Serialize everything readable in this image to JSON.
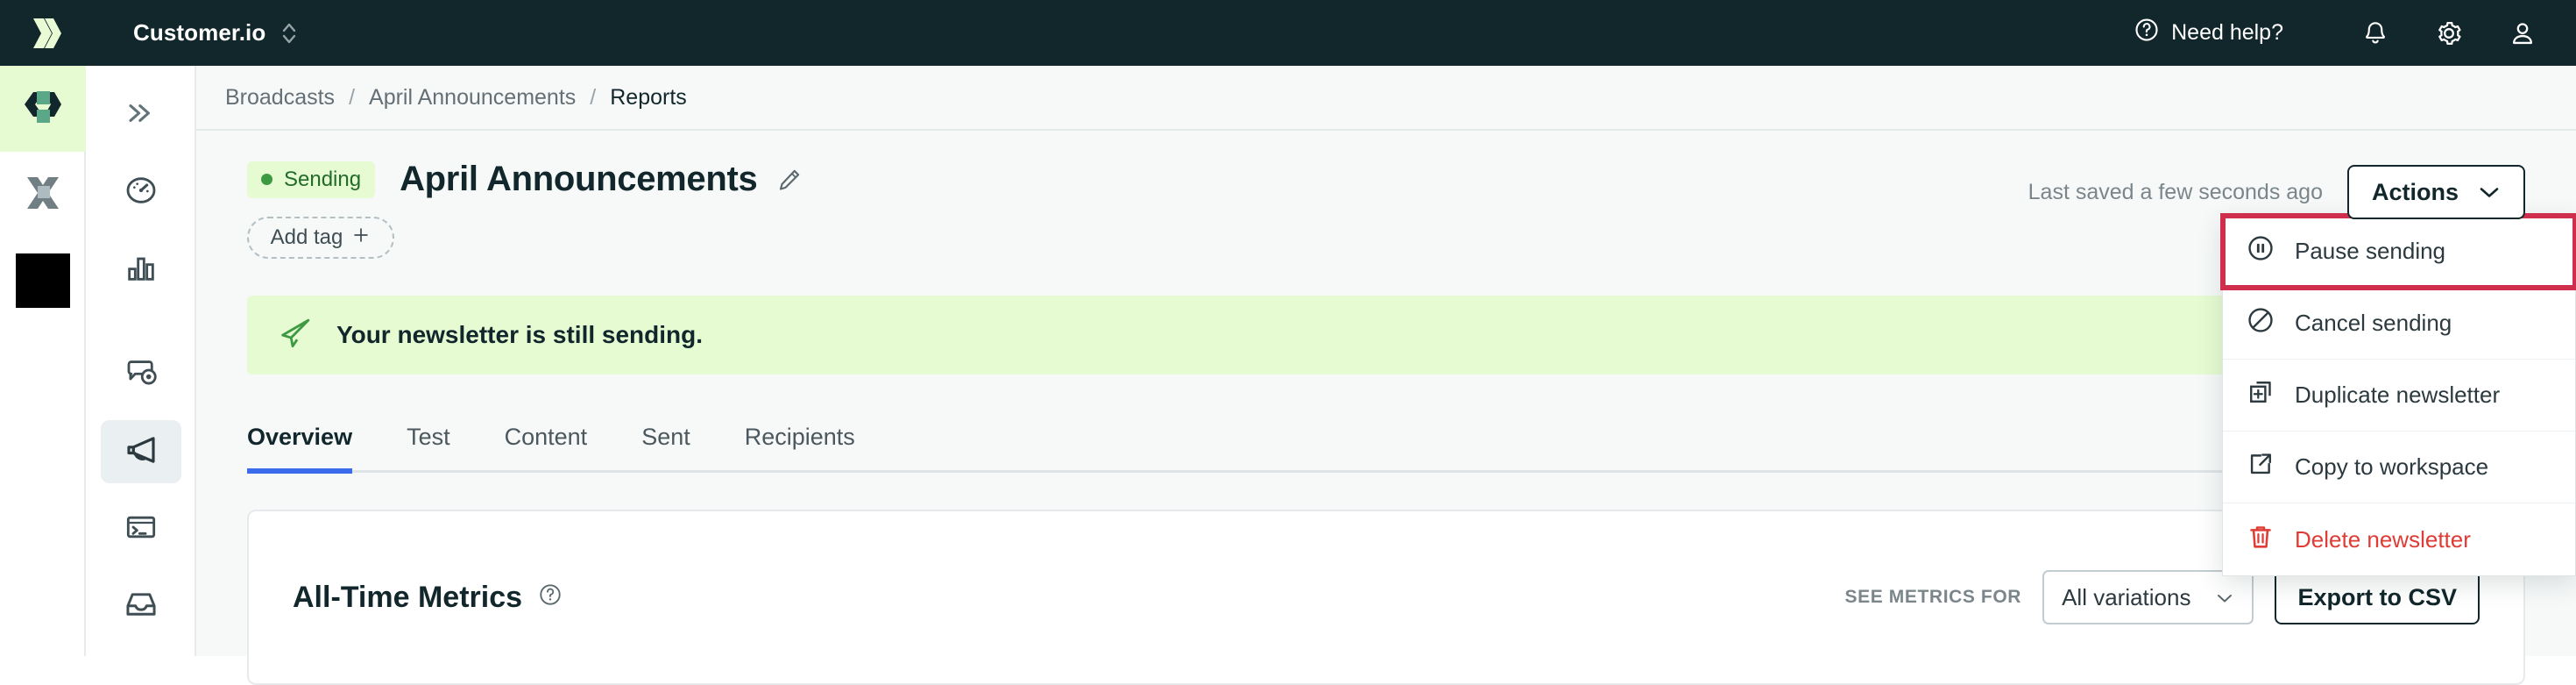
{
  "topbar": {
    "logo_icon": "customerio-logo-icon",
    "workspace_name": "Customer.io",
    "workspace_switcher_icon": "chevron-up-down-icon",
    "need_help_label": "Need help?",
    "help_icon": "question-circle-icon",
    "notifications_icon": "bell-icon",
    "settings_icon": "gear-icon",
    "account_icon": "user-icon"
  },
  "rail": {
    "items": [
      {
        "name": "workspace-customerio",
        "icon": "customerio-mark-icon",
        "active": true
      },
      {
        "name": "workspace-x",
        "icon": "x-mark-icon",
        "active": false
      },
      {
        "name": "workspace-black",
        "icon": "square-icon",
        "active": false
      }
    ]
  },
  "nav": {
    "collapse_icon": "chevrons-right-icon",
    "items": [
      {
        "name": "nav-dashboard",
        "icon": "gauge-icon",
        "active": false
      },
      {
        "name": "nav-analytics",
        "icon": "bar-chart-icon",
        "active": false
      },
      {
        "name": "nav-journeys",
        "icon": "message-eye-icon",
        "active": false
      },
      {
        "name": "nav-broadcasts",
        "icon": "megaphone-icon",
        "active": true
      },
      {
        "name": "nav-data",
        "icon": "terminal-icon",
        "active": false
      },
      {
        "name": "nav-inbox",
        "icon": "inbox-icon",
        "active": false
      }
    ]
  },
  "breadcrumb": {
    "items": [
      "Broadcasts",
      "April Announcements",
      "Reports"
    ],
    "separator": "/"
  },
  "header": {
    "status_badge": "Sending",
    "status_color": "#3d9a43",
    "title": "April Announcements",
    "edit_icon": "pencil-icon",
    "add_tag_label": "Add tag",
    "add_tag_icon": "plus-icon",
    "last_saved": "Last saved a few seconds ago",
    "actions_label": "Actions",
    "actions_caret_icon": "chevron-down-icon"
  },
  "dropdown": {
    "highlight_color": "#cf2f4d",
    "items": [
      {
        "label": "Pause sending",
        "icon": "pause-circle-icon",
        "danger": false,
        "highlight": true
      },
      {
        "label": "Cancel sending",
        "icon": "ban-icon",
        "danger": false,
        "highlight": false
      },
      {
        "label": "Duplicate newsletter",
        "icon": "duplicate-plus-icon",
        "danger": false,
        "highlight": false
      },
      {
        "label": "Copy to workspace",
        "icon": "external-link-icon",
        "danger": false,
        "highlight": false
      },
      {
        "label": "Delete newsletter",
        "icon": "trash-icon",
        "danger": true,
        "highlight": false
      }
    ]
  },
  "banner": {
    "icon": "paper-plane-icon",
    "text": "Your newsletter is still sending.",
    "bg_color": "#e6fbd2"
  },
  "tabs": {
    "items": [
      "Overview",
      "Test",
      "Content",
      "Sent",
      "Recipients"
    ],
    "active": "Overview",
    "active_color": "#3b6ceb"
  },
  "metrics_card": {
    "title": "All-Time Metrics",
    "help_icon": "question-circle-icon",
    "see_metrics_label": "SEE METRICS FOR",
    "variation_select_value": "All variations",
    "variation_caret_icon": "chevron-down-icon",
    "export_label": "Export to CSV"
  }
}
